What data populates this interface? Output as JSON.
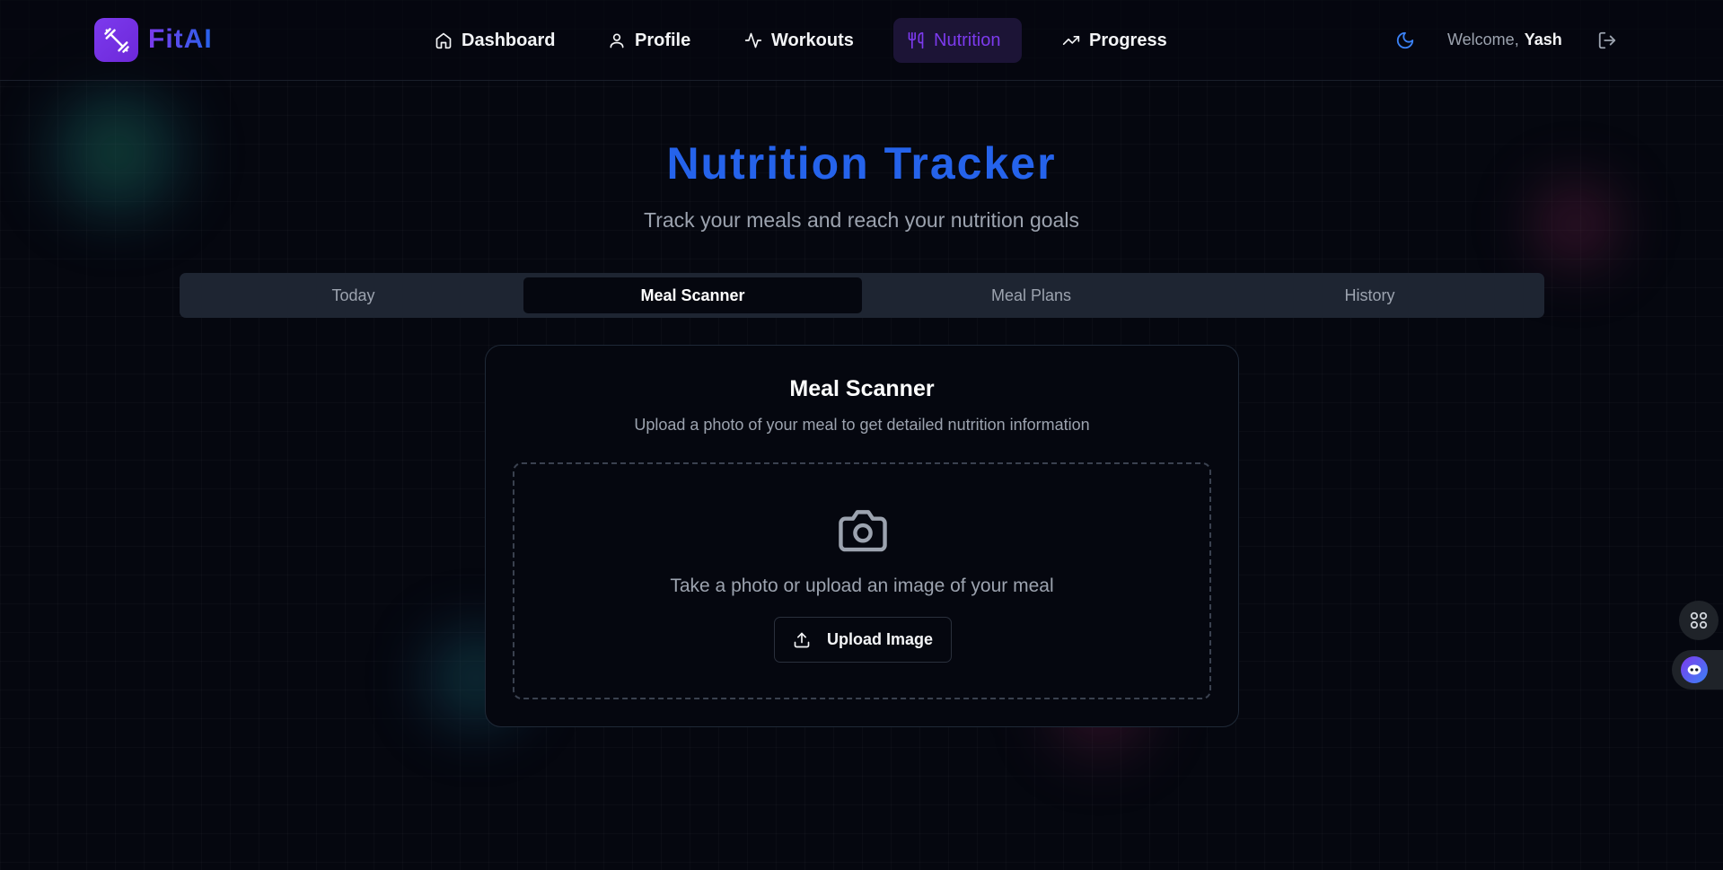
{
  "app": {
    "name": "FitAI"
  },
  "nav": {
    "items": [
      {
        "label": "Dashboard",
        "icon": "home-icon"
      },
      {
        "label": "Profile",
        "icon": "user-icon"
      },
      {
        "label": "Workouts",
        "icon": "activity-icon"
      },
      {
        "label": "Nutrition",
        "icon": "utensils-icon",
        "active": true
      },
      {
        "label": "Progress",
        "icon": "trending-up-icon"
      }
    ]
  },
  "user": {
    "welcome": "Welcome,",
    "name": "Yash"
  },
  "page": {
    "title": "Nutrition Tracker",
    "subtitle": "Track your meals and reach your nutrition goals"
  },
  "tabs": [
    {
      "label": "Today"
    },
    {
      "label": "Meal Scanner",
      "active": true
    },
    {
      "label": "Meal Plans"
    },
    {
      "label": "History"
    }
  ],
  "scanner": {
    "title": "Meal Scanner",
    "description": "Upload a photo of your meal to get detailed nutrition information",
    "drop_text": "Take a photo or upload an image of your meal",
    "upload_label": "Upload Image"
  },
  "colors": {
    "accent_purple": "#7c3aed",
    "title_blue": "#2563eb",
    "background": "#05070f"
  }
}
